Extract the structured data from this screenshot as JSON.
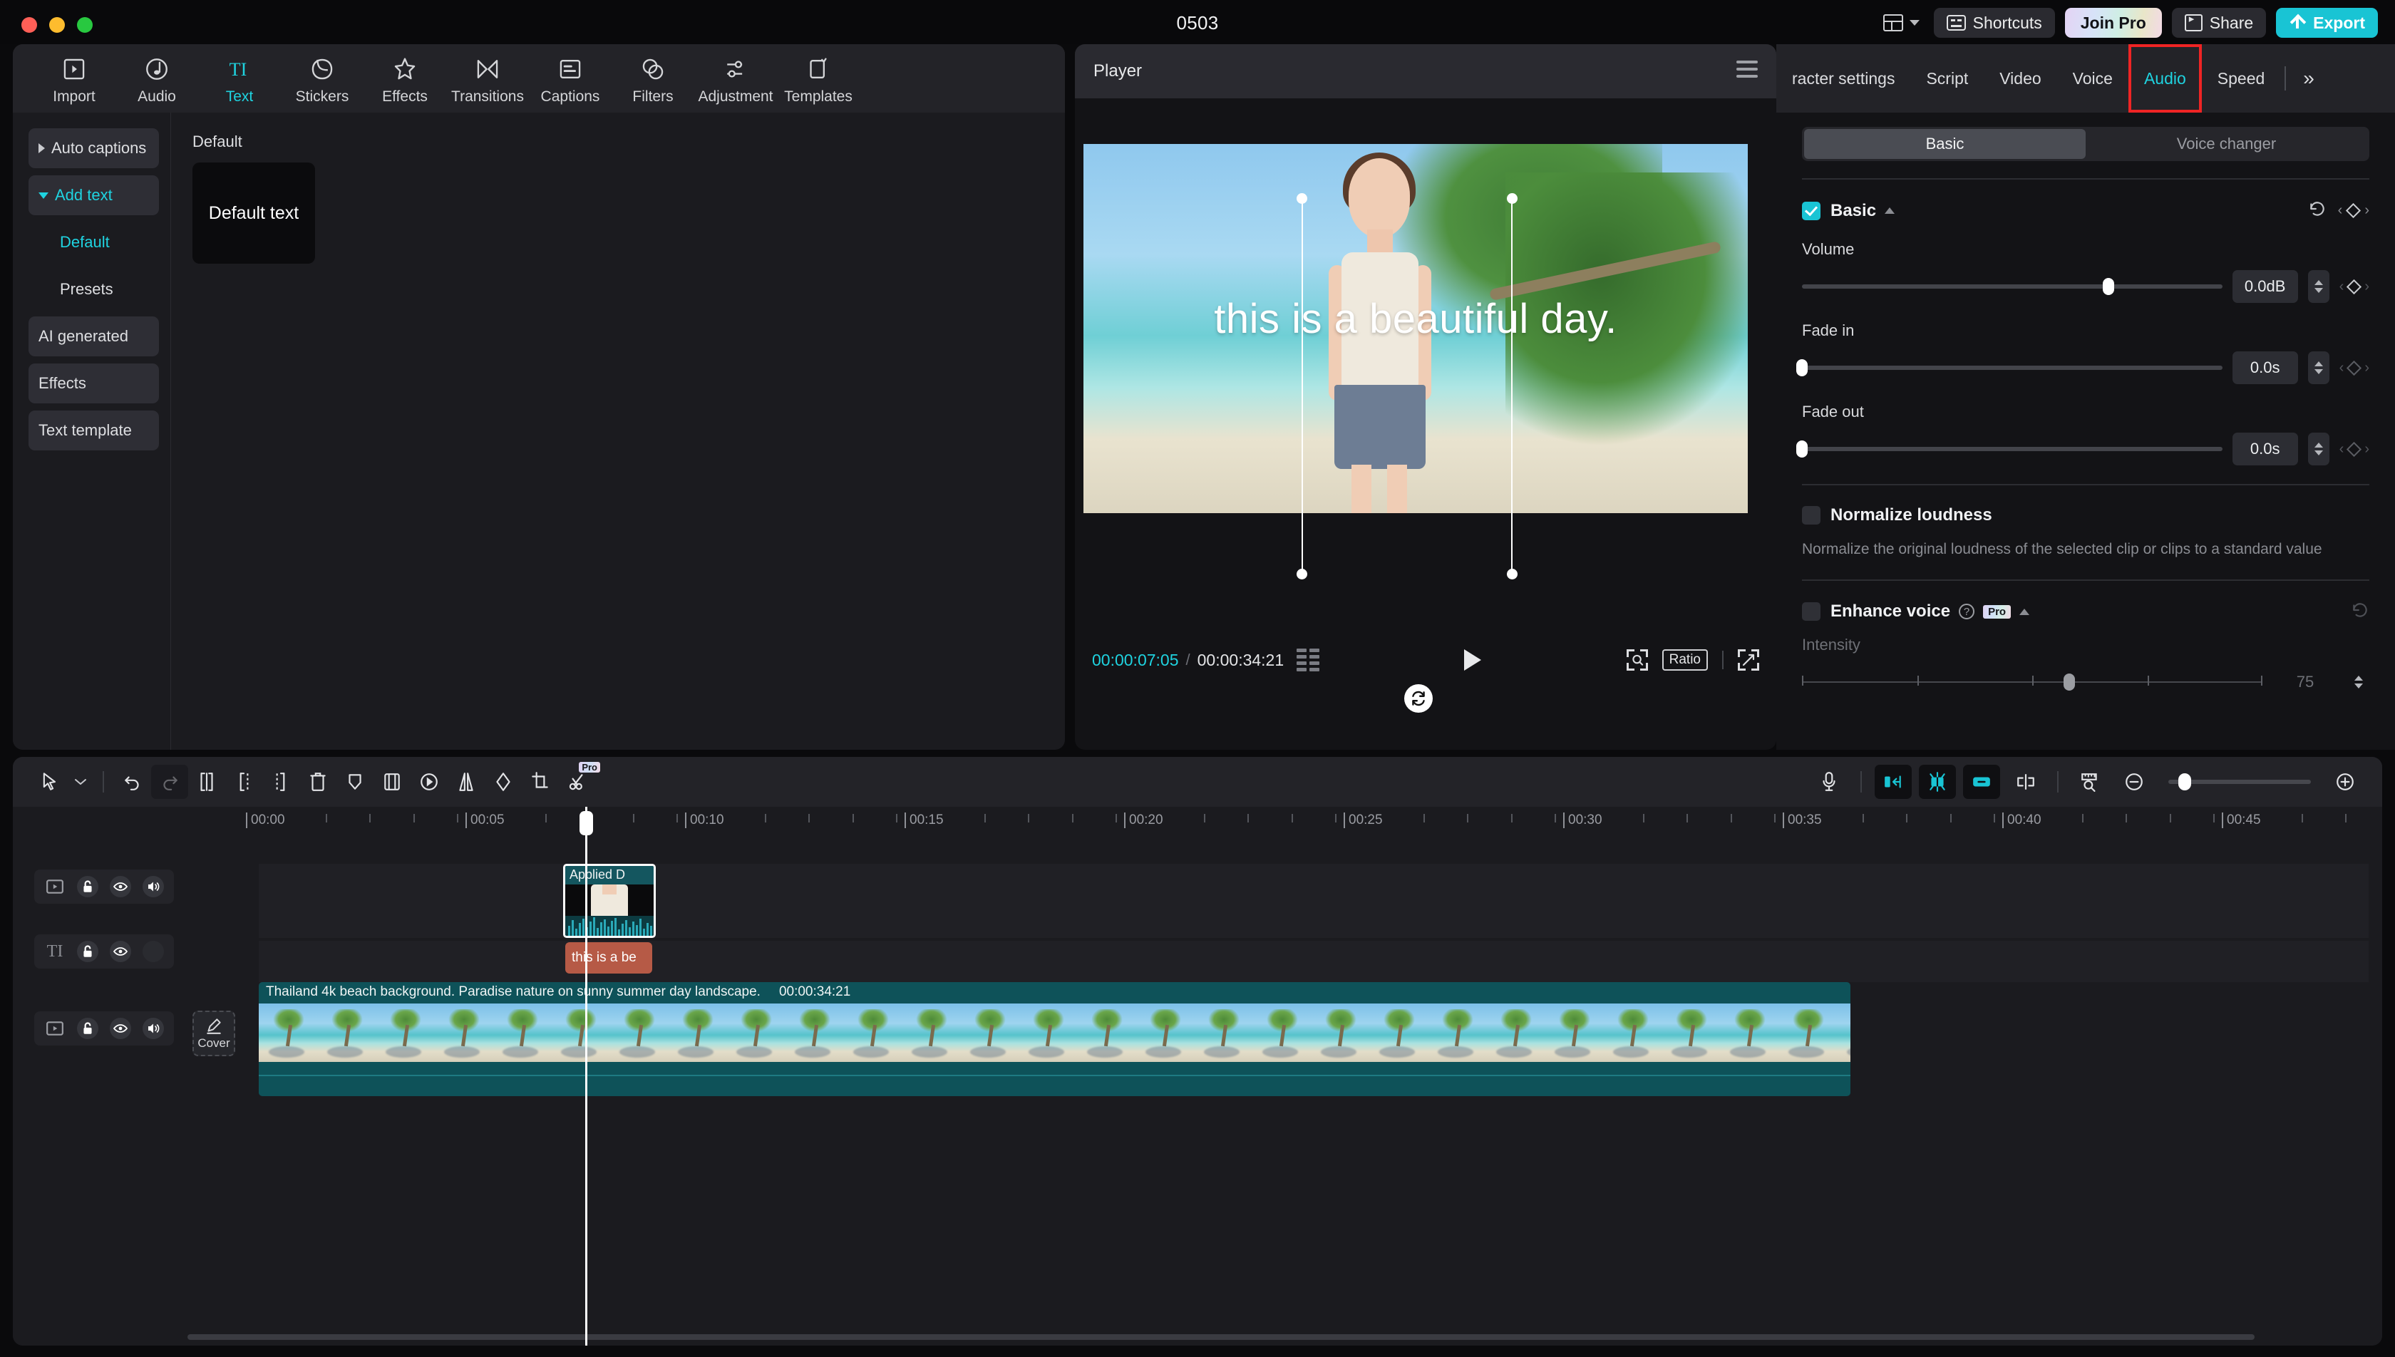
{
  "window": {
    "title": "0503"
  },
  "titlebar": {
    "layout_label": "",
    "shortcuts": "Shortcuts",
    "join_pro": "Join Pro",
    "share": "Share",
    "export": "Export"
  },
  "nav": {
    "items": [
      {
        "label": "Import",
        "icon": "import-icon",
        "active": false
      },
      {
        "label": "Audio",
        "icon": "audio-icon",
        "active": false
      },
      {
        "label": "Text",
        "icon": "text-icon",
        "active": true
      },
      {
        "label": "Stickers",
        "icon": "stickers-icon",
        "active": false
      },
      {
        "label": "Effects",
        "icon": "effects-icon",
        "active": false
      },
      {
        "label": "Transitions",
        "icon": "transitions-icon",
        "active": false
      },
      {
        "label": "Captions",
        "icon": "captions-icon",
        "active": false
      },
      {
        "label": "Filters",
        "icon": "filters-icon",
        "active": false
      },
      {
        "label": "Adjustment",
        "icon": "adjustment-icon",
        "active": false
      },
      {
        "label": "Templates",
        "icon": "templates-icon",
        "active": false
      }
    ]
  },
  "categories": [
    {
      "label": "Auto captions",
      "style": "box",
      "arrow": "right",
      "selected": false
    },
    {
      "label": "Add text",
      "style": "box",
      "arrow": "down",
      "selected": true
    },
    {
      "label": "Default",
      "style": "plain",
      "arrow": "none",
      "selected": true
    },
    {
      "label": "Presets",
      "style": "plain",
      "arrow": "none",
      "selected": false
    },
    {
      "label": "AI generated",
      "style": "box",
      "arrow": "none",
      "selected": false
    },
    {
      "label": "Effects",
      "style": "box",
      "arrow": "none",
      "selected": false
    },
    {
      "label": "Text template",
      "style": "box",
      "arrow": "none",
      "selected": false
    }
  ],
  "gallery": {
    "section_label": "Default",
    "cards": [
      {
        "label": "Default text"
      }
    ]
  },
  "player": {
    "title": "Player",
    "menu_icon": "hamburger-icon",
    "overlay_text": "this is a beautiful day.",
    "current_time": "00:00:07:05",
    "time_separator": "/",
    "total_time": "00:00:34:21",
    "ratio_label": "Ratio",
    "play_icon": "play-icon",
    "rotate_icon": "rotate-icon",
    "quality_icon": "quality-icon",
    "fullscreen_icon": "fullscreen-icon",
    "grid_icon": "grid-icon"
  },
  "right_panel": {
    "tabs": [
      {
        "label": "racter settings",
        "active": false,
        "highlight": false
      },
      {
        "label": "Script",
        "active": false,
        "highlight": false
      },
      {
        "label": "Video",
        "active": false,
        "highlight": false
      },
      {
        "label": "Voice",
        "active": false,
        "highlight": false
      },
      {
        "label": "Audio",
        "active": true,
        "highlight": true
      },
      {
        "label": "Speed",
        "active": false,
        "highlight": false
      }
    ],
    "overflow_label": "»",
    "segments": [
      {
        "label": "Basic",
        "on": true
      },
      {
        "label": "Voice changer",
        "on": false
      }
    ],
    "basic": {
      "title": "Basic",
      "checked": true,
      "reset_icon": "reset-icon",
      "keyframe_icon": "keyframe-diamond-icon",
      "volume": {
        "label": "Volume",
        "value": "0.0dB",
        "percent": 73
      },
      "fade_in": {
        "label": "Fade in",
        "value": "0.0s",
        "percent": 0
      },
      "fade_out": {
        "label": "Fade out",
        "value": "0.0s",
        "percent": 0
      }
    },
    "normalize": {
      "label": "Normalize loudness",
      "checked": false,
      "description": "Normalize the original loudness of the selected clip or clips to a standard value"
    },
    "enhance": {
      "label": "Enhance voice",
      "checked": false,
      "badge": "Pro",
      "help_icon": "question-icon",
      "intensity_label": "Intensity",
      "intensity_value": "75",
      "intensity_percent": 58
    }
  },
  "timeline": {
    "tools_left": [
      {
        "name": "select-tool",
        "icon": "cursor-icon",
        "disabled": false
      },
      {
        "name": "select-dropdown",
        "icon": "chevron-down-icon",
        "disabled": false
      },
      {
        "name": "undo",
        "icon": "undo-icon",
        "disabled": false
      },
      {
        "name": "redo",
        "icon": "redo-icon",
        "disabled": true
      },
      {
        "name": "split",
        "icon": "split-icon",
        "disabled": false
      },
      {
        "name": "trim-start",
        "icon": "trim-start-icon",
        "disabled": false
      },
      {
        "name": "trim-end",
        "icon": "trim-end-icon",
        "disabled": false
      },
      {
        "name": "delete",
        "icon": "trash-icon",
        "disabled": false
      },
      {
        "name": "marker",
        "icon": "marker-icon",
        "disabled": false
      },
      {
        "name": "crop-frame",
        "icon": "frame-icon",
        "disabled": false
      },
      {
        "name": "speed",
        "icon": "speed-icon",
        "disabled": false
      },
      {
        "name": "mirror",
        "icon": "mirror-icon",
        "disabled": false
      },
      {
        "name": "mask",
        "icon": "mask-icon",
        "disabled": false
      },
      {
        "name": "crop",
        "icon": "crop-icon",
        "disabled": false
      },
      {
        "name": "smart-cutout",
        "icon": "scissors-icon",
        "disabled": false,
        "pro": true
      }
    ],
    "tools_right": [
      {
        "name": "record-voiceover",
        "icon": "microphone-icon",
        "active": false
      },
      {
        "name": "snap-left",
        "icon": "snap-left-icon",
        "active": true
      },
      {
        "name": "magnetic-snap",
        "icon": "magnet-snap-icon",
        "active": true
      },
      {
        "name": "link",
        "icon": "link-icon",
        "active": true
      },
      {
        "name": "split-view",
        "icon": "split-view-icon",
        "active": false
      },
      {
        "name": "zoom-to-fit",
        "icon": "ruler-icon",
        "active": false
      },
      {
        "name": "zoom-out",
        "icon": "zoom-out-icon",
        "active": false
      },
      {
        "name": "zoom-in",
        "icon": "zoom-in-icon",
        "active": false
      }
    ],
    "ruler_labels": [
      "00:00",
      "00:05",
      "00:10",
      "00:15",
      "00:20",
      "00:25",
      "00:30",
      "00:35",
      "00:40",
      "00:45"
    ],
    "playhead_time": "00:00:07:05",
    "cover_label": "Cover",
    "tracks": [
      {
        "name": "video-track-1",
        "controls": [
          "video-icon",
          "unlock-icon",
          "eye-icon",
          "speaker-icon"
        ],
        "clips": [
          {
            "type": "video",
            "title": "Applied  D",
            "selected": true
          }
        ]
      },
      {
        "name": "text-track-1",
        "controls": [
          "text-icon",
          "unlock-icon",
          "eye-icon",
          "mute-placeholder"
        ],
        "clips": [
          {
            "type": "text",
            "title": "this is a be"
          }
        ]
      },
      {
        "name": "video-track-main",
        "controls": [
          "video-icon",
          "unlock-icon",
          "eye-icon",
          "speaker-icon"
        ],
        "clips": [
          {
            "type": "background",
            "title": "Thailand 4k beach background. Paradise nature on sunny summer day landscape.",
            "duration": "00:00:34:21"
          }
        ]
      }
    ]
  }
}
